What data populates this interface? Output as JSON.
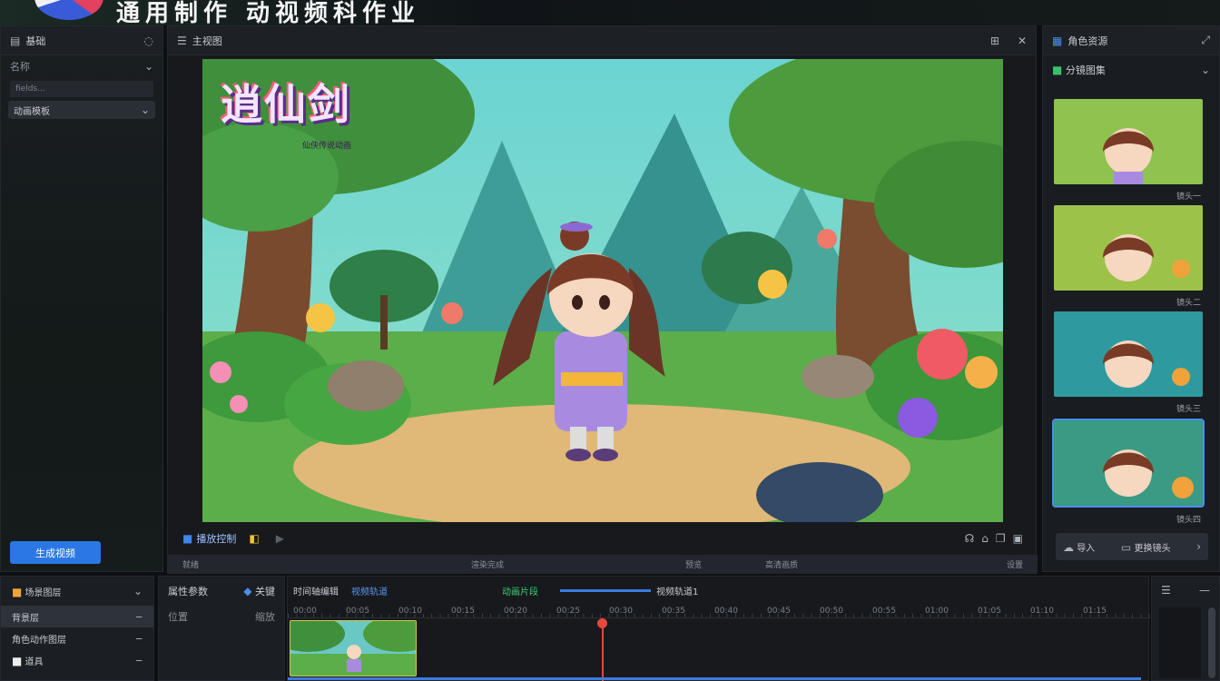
{
  "banner": {
    "title": "通用制作 动视频科作业"
  },
  "left_panel": {
    "title": "基础",
    "field_label": "名称",
    "input_value": "fields...",
    "select_value": "动画模板",
    "primary_button": "生成视频"
  },
  "preview": {
    "title": "主视图",
    "logo_text": "逍仙剑",
    "logo_sub": "仙侠传说动画",
    "play_label": "播放控制",
    "status_left": "就绪",
    "status_center": "渲染完成",
    "status_right_a": "预览",
    "status_right_b": "高清画质",
    "status_far_right": "设置"
  },
  "right_panel": {
    "title": "角色资源",
    "section": "分镜图集",
    "captions": [
      "镜头一",
      "镜头二",
      "镜头三",
      "镜头四"
    ],
    "foot_left": "导入",
    "foot_right": "更换镜头"
  },
  "bottom_left": {
    "title": "场景图层",
    "items": [
      "背景层",
      "角色动作图层",
      "道具"
    ]
  },
  "props": {
    "title": "属性参数",
    "label_a": "关键",
    "label_b": "位置",
    "label_c": "缩放"
  },
  "timeline": {
    "title": "时间轴编辑",
    "tab": "视频轨道",
    "track_label": "视频轨道1",
    "clip_label": "动画片段",
    "labels": [
      "00:00",
      "00:05",
      "00:10",
      "00:15",
      "00:20",
      "00:25",
      "00:30",
      "00:35",
      "00:40",
      "00:45",
      "00:50",
      "00:55",
      "01:00",
      "01:05",
      "01:10",
      "01:15"
    ]
  },
  "colors": {
    "accent": "#2b78e4",
    "playhead": "#e8473b",
    "clip_border": "#d6c74a"
  }
}
